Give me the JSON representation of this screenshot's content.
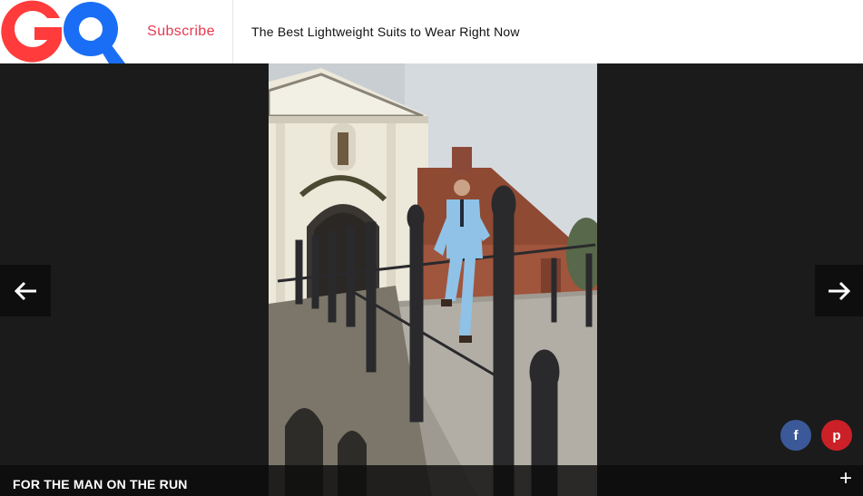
{
  "header": {
    "logo_text": "GQ",
    "subscribe_label": "Subscribe",
    "article_title": "The Best Lightweight Suits to Wear Right Now"
  },
  "gallery": {
    "caption": "FOR THE MAN ON THE RUN",
    "expand_label": "+",
    "prev_icon": "arrow-left-icon",
    "next_icon": "arrow-right-icon"
  },
  "share": {
    "facebook_glyph": "f",
    "pinterest_glyph": "p"
  },
  "colors": {
    "logo_red": "#ff3b3b",
    "logo_blue": "#1a6ef5",
    "subscribe_red": "#e8384f",
    "facebook": "#3b5998",
    "pinterest": "#cb2027"
  }
}
